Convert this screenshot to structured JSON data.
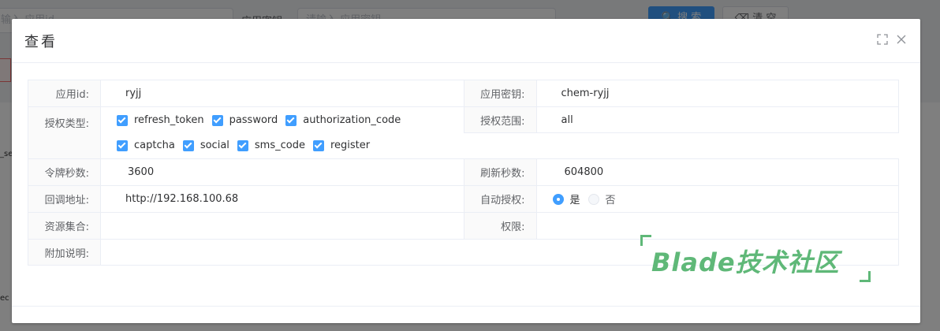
{
  "background": {
    "search_input_1": "输入 应用id",
    "label_secret": "应用密钥:",
    "search_input_2": "请输入 应用密钥",
    "search_button": "搜 索",
    "reset_button": "清 空",
    "side_text_1": "_se",
    "side_text_2": "ec"
  },
  "dialog": {
    "title": "查看"
  },
  "form": {
    "client_id": {
      "label": "应用id:",
      "value": "ryjj"
    },
    "client_secret": {
      "label": "应用密钥:",
      "value": "chem-ryjj"
    },
    "grant_types": {
      "label": "授权类型:",
      "options": [
        "refresh_token",
        "password",
        "authorization_code",
        "captcha",
        "social",
        "sms_code",
        "register"
      ]
    },
    "scope": {
      "label": "授权范围:",
      "value": "all"
    },
    "access_token_validity": {
      "label": "令牌秒数:",
      "value": "3600"
    },
    "refresh_token_validity": {
      "label": "刷新秒数:",
      "value": "604800"
    },
    "redirect_uri": {
      "label": "回调地址:",
      "value": "http://192.168.100.68"
    },
    "auto_approve": {
      "label": "自动授权:",
      "options": [
        "是",
        "否"
      ],
      "selected": "是"
    },
    "resource_ids": {
      "label": "资源集合:",
      "value": ""
    },
    "authorities": {
      "label": "权限:",
      "value": ""
    },
    "additional_info": {
      "label": "附加说明:",
      "value": ""
    }
  },
  "watermark": {
    "text": "Blade技术社区"
  },
  "colors": {
    "primary": "#409eff",
    "watermark": "#5fb878"
  }
}
